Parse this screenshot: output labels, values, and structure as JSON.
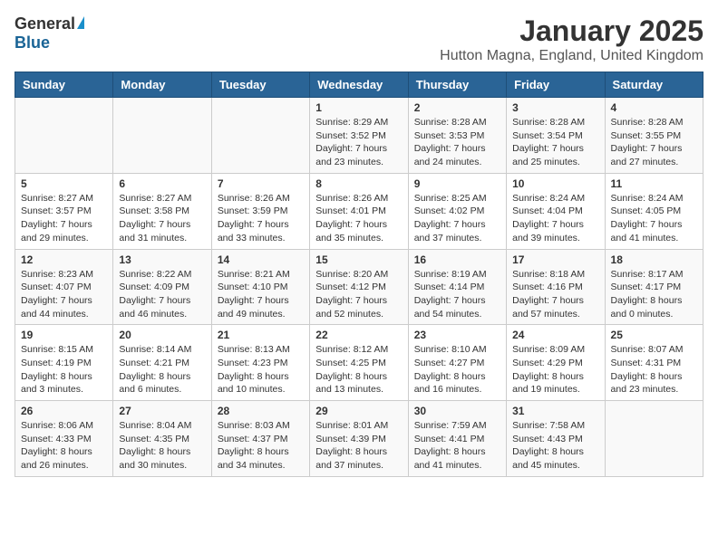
{
  "header": {
    "logo_general": "General",
    "logo_blue": "Blue",
    "title": "January 2025",
    "subtitle": "Hutton Magna, England, United Kingdom"
  },
  "columns": [
    "Sunday",
    "Monday",
    "Tuesday",
    "Wednesday",
    "Thursday",
    "Friday",
    "Saturday"
  ],
  "weeks": [
    [
      {
        "day": "",
        "detail": ""
      },
      {
        "day": "",
        "detail": ""
      },
      {
        "day": "",
        "detail": ""
      },
      {
        "day": "1",
        "detail": "Sunrise: 8:29 AM\nSunset: 3:52 PM\nDaylight: 7 hours\nand 23 minutes."
      },
      {
        "day": "2",
        "detail": "Sunrise: 8:28 AM\nSunset: 3:53 PM\nDaylight: 7 hours\nand 24 minutes."
      },
      {
        "day": "3",
        "detail": "Sunrise: 8:28 AM\nSunset: 3:54 PM\nDaylight: 7 hours\nand 25 minutes."
      },
      {
        "day": "4",
        "detail": "Sunrise: 8:28 AM\nSunset: 3:55 PM\nDaylight: 7 hours\nand 27 minutes."
      }
    ],
    [
      {
        "day": "5",
        "detail": "Sunrise: 8:27 AM\nSunset: 3:57 PM\nDaylight: 7 hours\nand 29 minutes."
      },
      {
        "day": "6",
        "detail": "Sunrise: 8:27 AM\nSunset: 3:58 PM\nDaylight: 7 hours\nand 31 minutes."
      },
      {
        "day": "7",
        "detail": "Sunrise: 8:26 AM\nSunset: 3:59 PM\nDaylight: 7 hours\nand 33 minutes."
      },
      {
        "day": "8",
        "detail": "Sunrise: 8:26 AM\nSunset: 4:01 PM\nDaylight: 7 hours\nand 35 minutes."
      },
      {
        "day": "9",
        "detail": "Sunrise: 8:25 AM\nSunset: 4:02 PM\nDaylight: 7 hours\nand 37 minutes."
      },
      {
        "day": "10",
        "detail": "Sunrise: 8:24 AM\nSunset: 4:04 PM\nDaylight: 7 hours\nand 39 minutes."
      },
      {
        "day": "11",
        "detail": "Sunrise: 8:24 AM\nSunset: 4:05 PM\nDaylight: 7 hours\nand 41 minutes."
      }
    ],
    [
      {
        "day": "12",
        "detail": "Sunrise: 8:23 AM\nSunset: 4:07 PM\nDaylight: 7 hours\nand 44 minutes."
      },
      {
        "day": "13",
        "detail": "Sunrise: 8:22 AM\nSunset: 4:09 PM\nDaylight: 7 hours\nand 46 minutes."
      },
      {
        "day": "14",
        "detail": "Sunrise: 8:21 AM\nSunset: 4:10 PM\nDaylight: 7 hours\nand 49 minutes."
      },
      {
        "day": "15",
        "detail": "Sunrise: 8:20 AM\nSunset: 4:12 PM\nDaylight: 7 hours\nand 52 minutes."
      },
      {
        "day": "16",
        "detail": "Sunrise: 8:19 AM\nSunset: 4:14 PM\nDaylight: 7 hours\nand 54 minutes."
      },
      {
        "day": "17",
        "detail": "Sunrise: 8:18 AM\nSunset: 4:16 PM\nDaylight: 7 hours\nand 57 minutes."
      },
      {
        "day": "18",
        "detail": "Sunrise: 8:17 AM\nSunset: 4:17 PM\nDaylight: 8 hours\nand 0 minutes."
      }
    ],
    [
      {
        "day": "19",
        "detail": "Sunrise: 8:15 AM\nSunset: 4:19 PM\nDaylight: 8 hours\nand 3 minutes."
      },
      {
        "day": "20",
        "detail": "Sunrise: 8:14 AM\nSunset: 4:21 PM\nDaylight: 8 hours\nand 6 minutes."
      },
      {
        "day": "21",
        "detail": "Sunrise: 8:13 AM\nSunset: 4:23 PM\nDaylight: 8 hours\nand 10 minutes."
      },
      {
        "day": "22",
        "detail": "Sunrise: 8:12 AM\nSunset: 4:25 PM\nDaylight: 8 hours\nand 13 minutes."
      },
      {
        "day": "23",
        "detail": "Sunrise: 8:10 AM\nSunset: 4:27 PM\nDaylight: 8 hours\nand 16 minutes."
      },
      {
        "day": "24",
        "detail": "Sunrise: 8:09 AM\nSunset: 4:29 PM\nDaylight: 8 hours\nand 19 minutes."
      },
      {
        "day": "25",
        "detail": "Sunrise: 8:07 AM\nSunset: 4:31 PM\nDaylight: 8 hours\nand 23 minutes."
      }
    ],
    [
      {
        "day": "26",
        "detail": "Sunrise: 8:06 AM\nSunset: 4:33 PM\nDaylight: 8 hours\nand 26 minutes."
      },
      {
        "day": "27",
        "detail": "Sunrise: 8:04 AM\nSunset: 4:35 PM\nDaylight: 8 hours\nand 30 minutes."
      },
      {
        "day": "28",
        "detail": "Sunrise: 8:03 AM\nSunset: 4:37 PM\nDaylight: 8 hours\nand 34 minutes."
      },
      {
        "day": "29",
        "detail": "Sunrise: 8:01 AM\nSunset: 4:39 PM\nDaylight: 8 hours\nand 37 minutes."
      },
      {
        "day": "30",
        "detail": "Sunrise: 7:59 AM\nSunset: 4:41 PM\nDaylight: 8 hours\nand 41 minutes."
      },
      {
        "day": "31",
        "detail": "Sunrise: 7:58 AM\nSunset: 4:43 PM\nDaylight: 8 hours\nand 45 minutes."
      },
      {
        "day": "",
        "detail": ""
      }
    ]
  ]
}
